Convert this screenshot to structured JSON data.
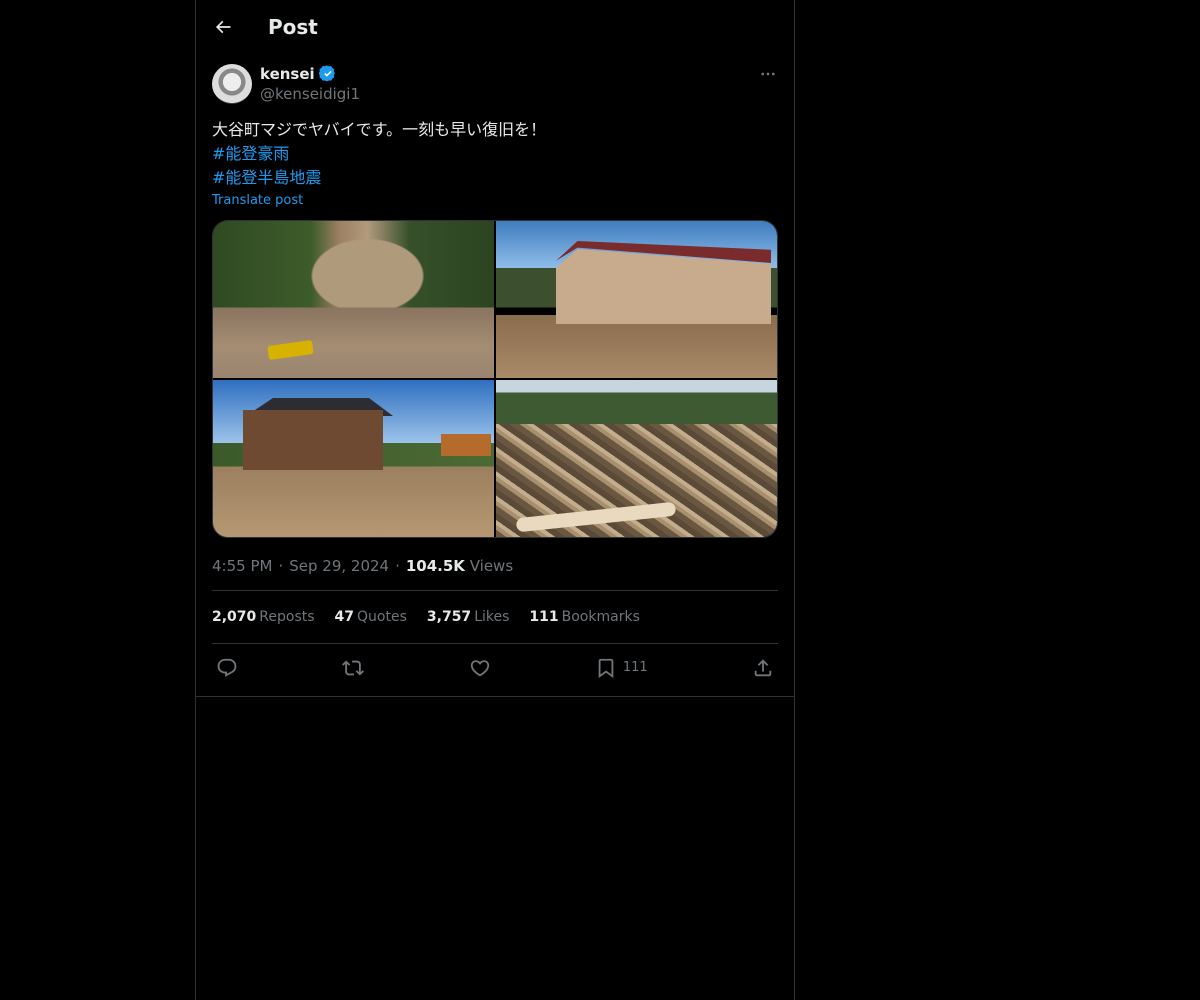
{
  "header": {
    "title": "Post"
  },
  "author": {
    "display_name": "kensei",
    "handle": "@kenseidigi1"
  },
  "post": {
    "text": "大谷町マジでヤバイです。一刻も早い復旧を！",
    "hashtags": [
      "#能登豪雨",
      "#能登半島地震"
    ],
    "translate_label": "Translate post",
    "time": "4:55 PM",
    "date": "Sep 29, 2024",
    "views_count": "104.5K",
    "views_label": "Views"
  },
  "stats": {
    "reposts_count": "2,070",
    "reposts_label": "Reposts",
    "quotes_count": "47",
    "quotes_label": "Quotes",
    "likes_count": "3,757",
    "likes_label": "Likes",
    "bookmarks_count": "111",
    "bookmarks_label": "Bookmarks"
  },
  "actions": {
    "bookmark_count": "111"
  },
  "colors": {
    "accent": "#1d9bf0",
    "background": "#000000",
    "border": "#2f3336",
    "muted_text": "#71767b",
    "primary_text": "#e7e9ea"
  },
  "icons": [
    "back-arrow-icon",
    "verified-badge-icon",
    "more-icon",
    "reply-icon",
    "repost-icon",
    "like-icon",
    "bookmark-icon",
    "share-icon"
  ]
}
